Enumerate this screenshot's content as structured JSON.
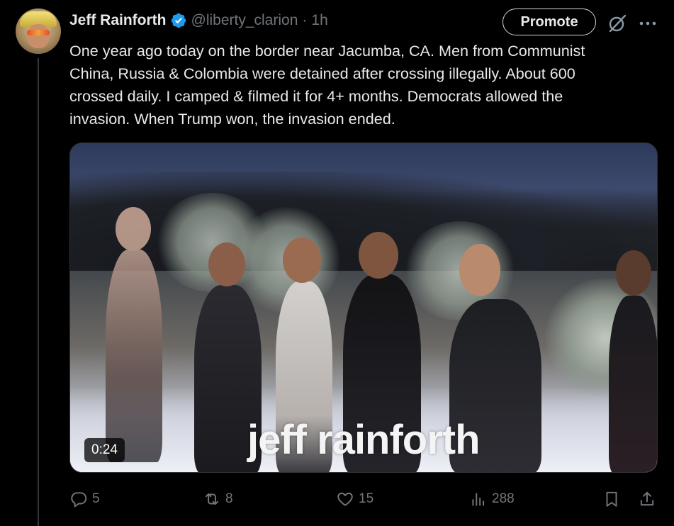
{
  "author": {
    "name": "Jeff Rainforth",
    "handle": "@liberty_clarion",
    "separator": "·",
    "time": "1h"
  },
  "header_buttons": {
    "promote_label": "Promote",
    "grok_icon": "slash-circle-icon",
    "more_icon": "more-horizontal-icon"
  },
  "tweet": {
    "text_lines": [
      "One year ago today on the border near Jacumba, CA. Men from Communist",
      "China, Russia & Colombia were detained after crossing illegally. About 600",
      "crossed daily. I camped & filmed it for 4+ months. Democrats allowed the",
      "invasion. When Trump won, the invasion ended."
    ]
  },
  "media": {
    "watermark": "jeff rainforth",
    "duration": "0:24"
  },
  "actions": {
    "replies": "5",
    "reposts": "8",
    "likes": "15",
    "views": "288"
  },
  "colors": {
    "background": "#000000",
    "text": "#e7e9ea",
    "muted": "#71767b",
    "verified": "#1d9bf0"
  }
}
